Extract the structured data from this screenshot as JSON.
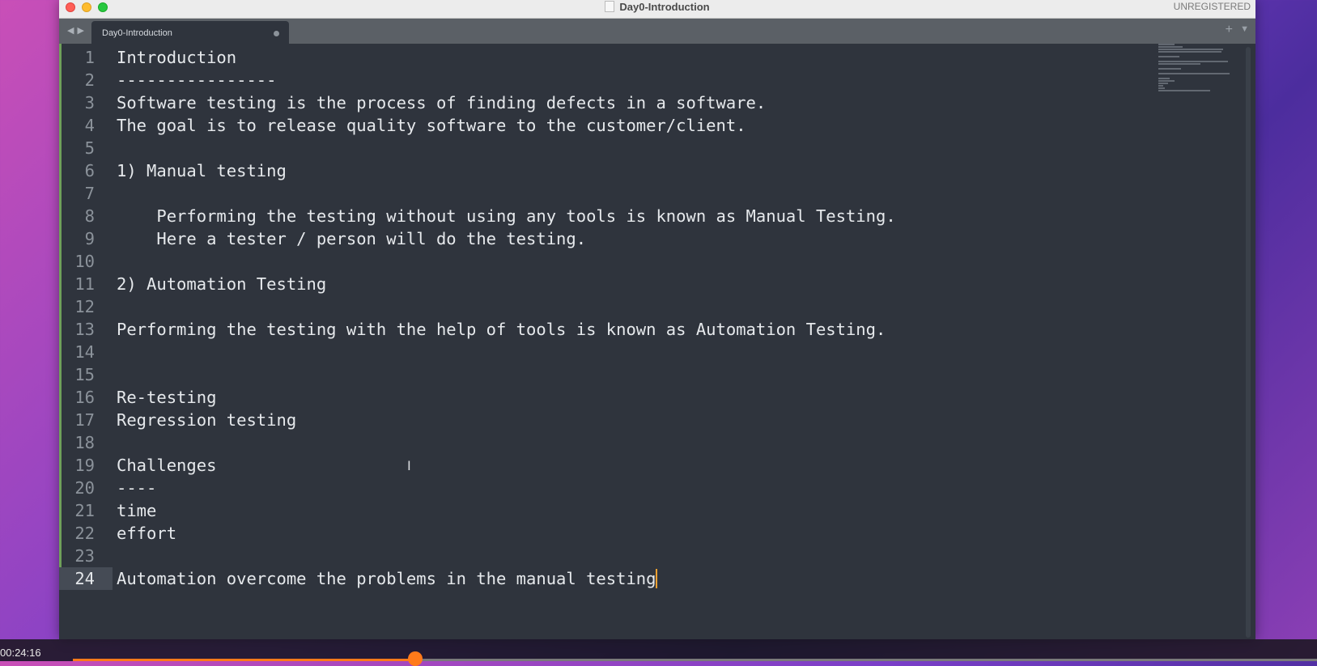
{
  "window": {
    "title": "Day0-Introduction",
    "license_status": "UNREGISTERED"
  },
  "tabs": [
    {
      "label": "Day0-Introduction",
      "modified": true
    }
  ],
  "editor": {
    "current_line": 24,
    "lines": [
      {
        "num": "1",
        "text": "Introduction"
      },
      {
        "num": "2",
        "text": "----------------"
      },
      {
        "num": "3",
        "text": "Software testing is the process of finding defects in a software."
      },
      {
        "num": "4",
        "text": "The goal is to release quality software to the customer/client."
      },
      {
        "num": "5",
        "text": ""
      },
      {
        "num": "6",
        "text": "1) Manual testing"
      },
      {
        "num": "7",
        "text": ""
      },
      {
        "num": "8",
        "text": "    Performing the testing without using any tools is known as Manual Testing."
      },
      {
        "num": "9",
        "text": "    Here a tester / person will do the testing."
      },
      {
        "num": "10",
        "text": ""
      },
      {
        "num": "11",
        "text": "2) Automation Testing"
      },
      {
        "num": "12",
        "text": ""
      },
      {
        "num": "13",
        "text": "Performing the testing with the help of tools is known as Automation Testing."
      },
      {
        "num": "14",
        "text": ""
      },
      {
        "num": "15",
        "text": ""
      },
      {
        "num": "16",
        "text": "Re-testing"
      },
      {
        "num": "17",
        "text": "Regression testing"
      },
      {
        "num": "18",
        "text": ""
      },
      {
        "num": "19",
        "text": "Challenges"
      },
      {
        "num": "20",
        "text": "----"
      },
      {
        "num": "21",
        "text": "time"
      },
      {
        "num": "22",
        "text": "effort"
      },
      {
        "num": "23",
        "text": ""
      },
      {
        "num": "24",
        "text": "Automation overcome the problems in the manual testing"
      }
    ]
  },
  "player": {
    "timecode": "00:24:16",
    "progress_fraction": 0.275
  },
  "colors": {
    "editor_bg": "#2f343d",
    "caret": "#f0a030",
    "progress": "#ff7a1a",
    "modified_bar": "#6fa05a"
  }
}
